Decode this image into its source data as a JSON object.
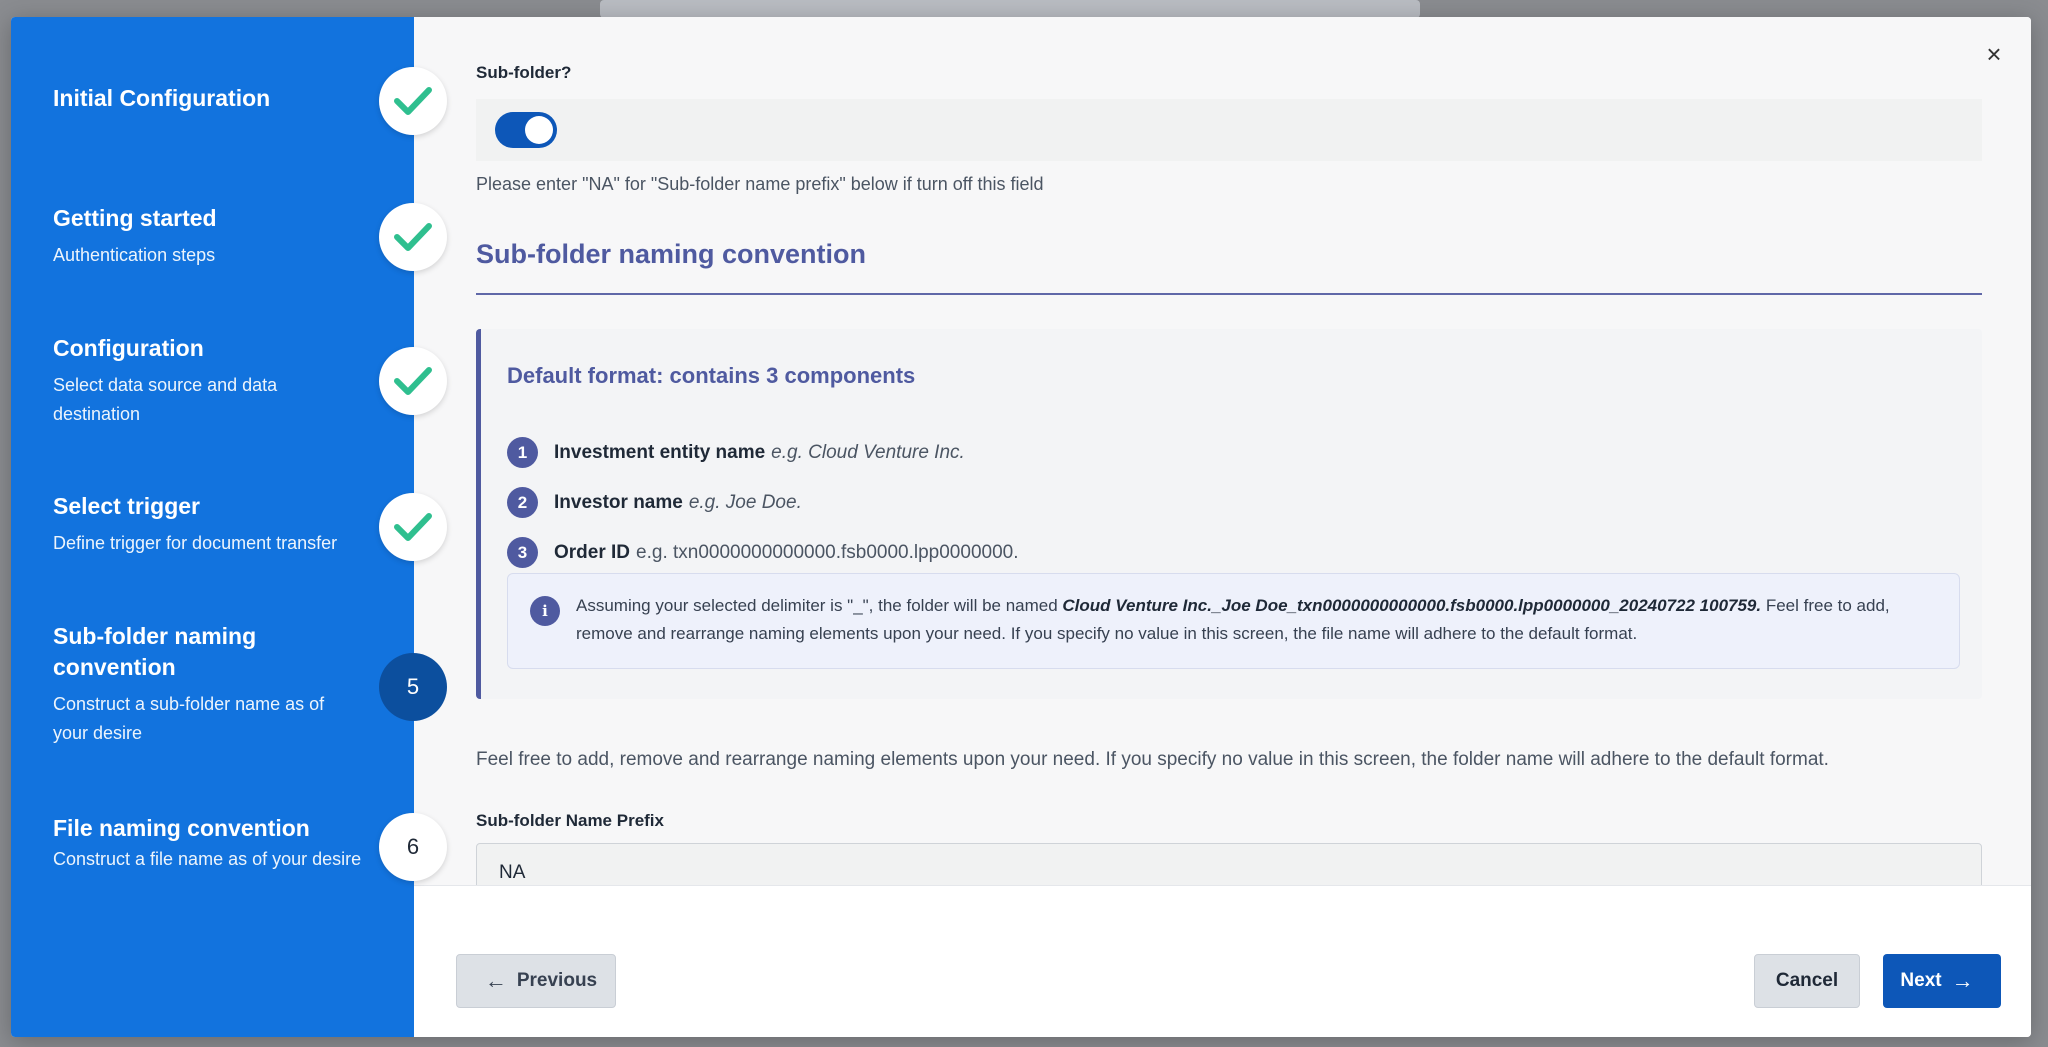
{
  "sidebar": {
    "steps": [
      {
        "title": "Initial Configuration",
        "subtitle": "",
        "status": "done"
      },
      {
        "title": "Getting started",
        "subtitle": "Authentication steps",
        "status": "done"
      },
      {
        "title": "Configuration",
        "subtitle": "Select data source and data destination",
        "status": "done"
      },
      {
        "title": "Select trigger",
        "subtitle": "Define trigger for document transfer",
        "status": "done"
      },
      {
        "title": "Sub-folder naming convention",
        "subtitle": "Construct a sub-folder name as of your desire",
        "status": "active",
        "number": "5"
      },
      {
        "title": "File naming convention",
        "subtitle": "Construct a file name as of your desire",
        "status": "pending",
        "number": "6"
      }
    ]
  },
  "main": {
    "close_label": "×",
    "subfolder_label": "Sub-folder?",
    "subfolder_toggle_on": true,
    "toggle_hint": "Please enter \"NA\" for \"Sub-folder name prefix\" below if turn off this field",
    "section_title": "Sub-folder naming convention",
    "format": {
      "title": "Default format: contains 3 components",
      "components": [
        {
          "number": "1",
          "name": "Investment entity name",
          "example": "e.g. Cloud Venture Inc."
        },
        {
          "number": "2",
          "name": "Investor name",
          "example": "e.g. Joe Doe."
        },
        {
          "number": "3",
          "name": "Order ID",
          "example": "e.g. txn0000000000000.fsb0000.lpp0000000."
        }
      ],
      "info": {
        "icon": "i",
        "prefix": "Assuming your selected delimiter is \"_\", the folder will be named ",
        "example": "Cloud Venture Inc._Joe Doe_txn0000000000000.fsb0000.lpp0000000_20240722 100759.",
        "suffix": " Feel free to add, remove and rearrange naming elements upon your need. If you specify no value in this screen, the file name will adhere to the default format."
      }
    },
    "free_text": "Feel free to add, remove and rearrange naming elements upon your need. If you specify no value in this screen, the folder name will adhere to the default format.",
    "prefix_label": "Sub-folder Name Prefix",
    "prefix_value": "NA"
  },
  "footer": {
    "previous_label": "Previous",
    "cancel_label": "Cancel",
    "next_label": "Next"
  },
  "colors": {
    "sidebar": "#1273de",
    "accent": "#4f5aa0",
    "primary_button": "#0d57b8",
    "check": "#2fbf8f"
  }
}
